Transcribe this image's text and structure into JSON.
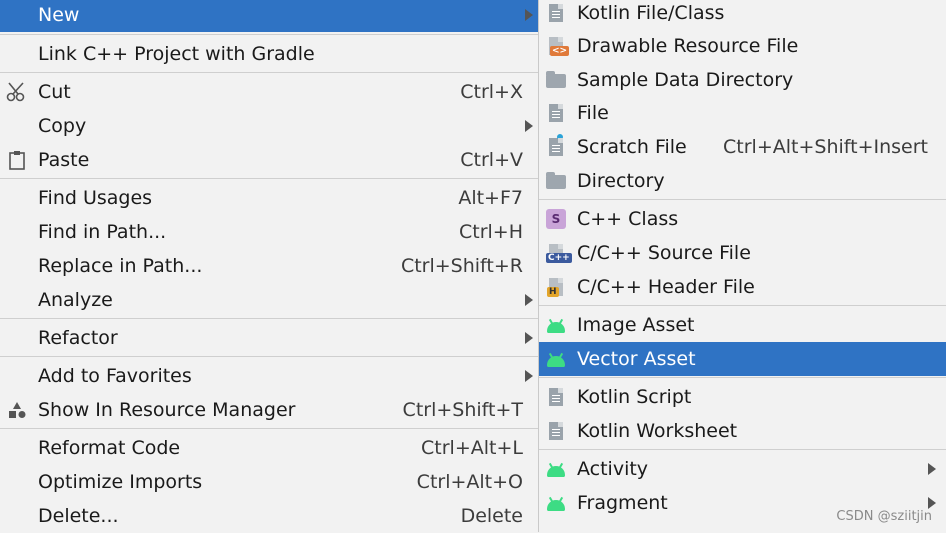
{
  "left_menu": {
    "items": [
      {
        "label": "New",
        "has_submenu": true
      },
      {
        "label": "Link C++ Project with Gradle"
      },
      {
        "label": "Cut",
        "shortcut": "Ctrl+X",
        "icon": "scissors-icon"
      },
      {
        "label": "Copy",
        "has_submenu": true
      },
      {
        "label": "Paste",
        "shortcut": "Ctrl+V",
        "icon": "clipboard-icon"
      },
      {
        "label": "Find Usages",
        "shortcut": "Alt+F7"
      },
      {
        "label": "Find in Path...",
        "shortcut": "Ctrl+H"
      },
      {
        "label": "Replace in Path...",
        "shortcut": "Ctrl+Shift+R"
      },
      {
        "label": "Analyze",
        "has_submenu": true
      },
      {
        "label": "Refactor",
        "has_submenu": true
      },
      {
        "label": "Add to Favorites",
        "has_submenu": true
      },
      {
        "label": "Show In Resource Manager",
        "shortcut": "Ctrl+Shift+T",
        "icon": "resource-manager-icon"
      },
      {
        "label": "Reformat Code",
        "shortcut": "Ctrl+Alt+L"
      },
      {
        "label": "Optimize Imports",
        "shortcut": "Ctrl+Alt+O"
      },
      {
        "label": "Delete...",
        "shortcut": "Delete"
      }
    ]
  },
  "right_menu": {
    "items": [
      {
        "label": "Kotlin File/Class",
        "icon": "kotlin-file-icon"
      },
      {
        "label": "Drawable Resource File",
        "icon": "drawable-file-icon"
      },
      {
        "label": "Sample Data Directory",
        "icon": "folder-icon"
      },
      {
        "label": "File",
        "icon": "file-icon"
      },
      {
        "label": "Scratch File",
        "shortcut": "Ctrl+Alt+Shift+Insert",
        "icon": "scratch-file-icon"
      },
      {
        "label": "Directory",
        "icon": "folder-icon"
      },
      {
        "label": "C++ Class",
        "icon": "cpp-class-icon",
        "badge": "S"
      },
      {
        "label": "C/C++ Source File",
        "icon": "cpp-source-icon",
        "badge": "C++"
      },
      {
        "label": "C/C++ Header File",
        "icon": "cpp-header-icon",
        "badge": "H"
      },
      {
        "label": "Image Asset",
        "icon": "android-icon"
      },
      {
        "label": "Vector Asset",
        "icon": "android-icon"
      },
      {
        "label": "Kotlin Script",
        "icon": "kotlin-script-icon"
      },
      {
        "label": "Kotlin Worksheet",
        "icon": "kotlin-worksheet-icon"
      },
      {
        "label": "Activity",
        "icon": "android-icon",
        "has_submenu": true
      },
      {
        "label": "Fragment",
        "icon": "android-icon",
        "has_submenu": true
      }
    ]
  },
  "watermark": "CSDN @sziitjin",
  "colors": {
    "selection": "#2f73c4",
    "android_green": "#3ddc84",
    "menu_bg": "#f2f2f2"
  }
}
